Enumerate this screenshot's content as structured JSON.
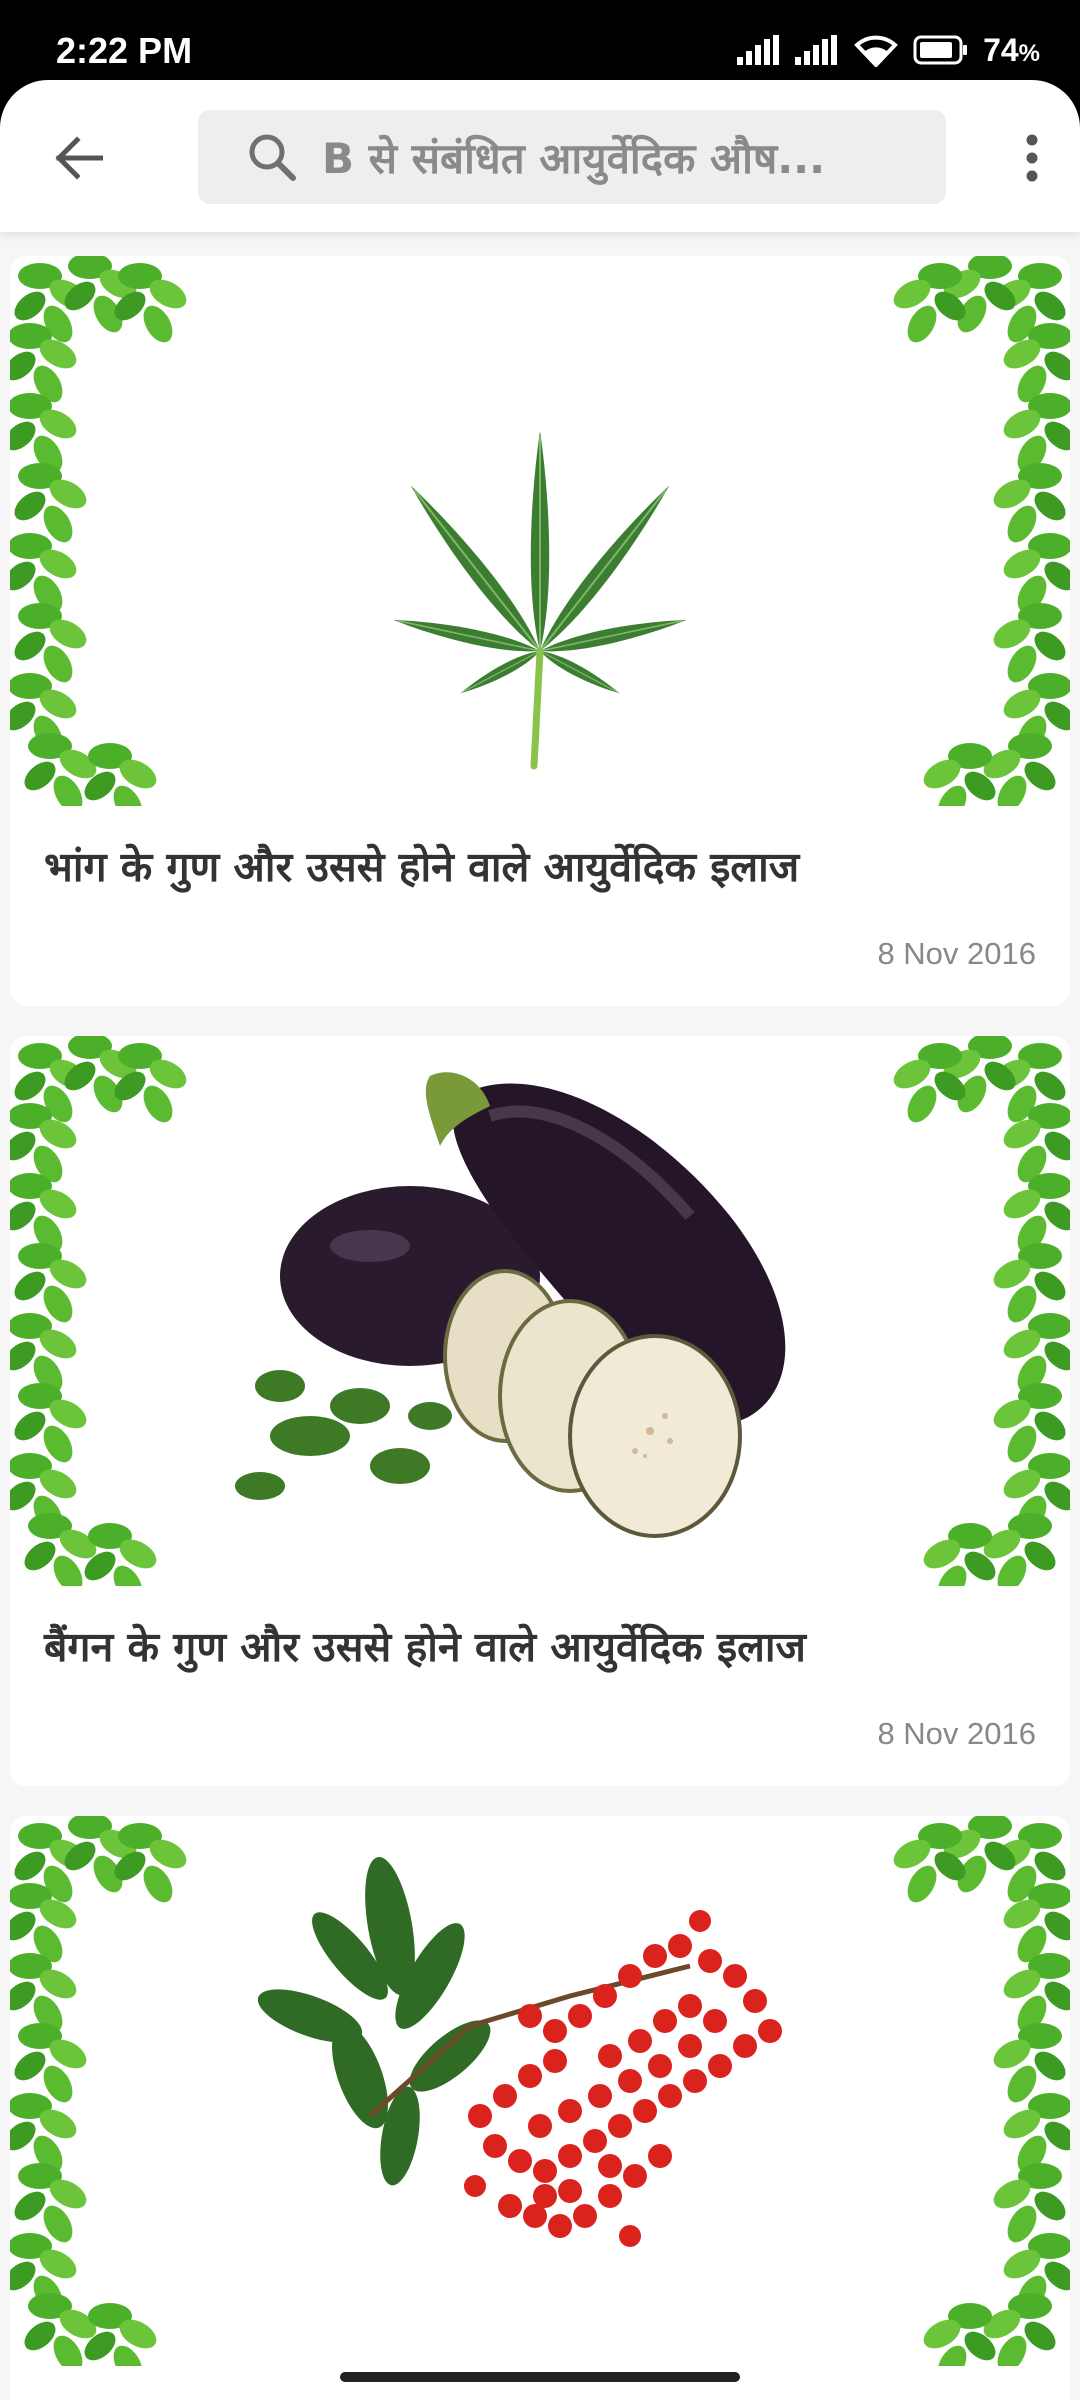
{
  "status_bar": {
    "time": "2:22 PM",
    "battery": "74"
  },
  "app_bar": {
    "search_text": "B से संबंधित आयुर्वेदिक औष..."
  },
  "articles": [
    {
      "title": "भांग के गुण और उससे होने वाले आयुर्वेदिक इलाज",
      "date": "8 Nov 2016",
      "image_icon": "cannabis-leaf-image"
    },
    {
      "title": "बैंगन के गुण और उससे होने वाले आयुर्वेदिक इलाज",
      "date": "8 Nov 2016",
      "image_icon": "eggplant-image"
    },
    {
      "title": "",
      "date": "",
      "image_icon": "red-berries-image"
    }
  ],
  "colors": {
    "leaf_green": "#4caf2a",
    "dark_leaf": "#2e7d1f",
    "eggplant": "#2a1a2e",
    "berry_red": "#d9231c"
  }
}
